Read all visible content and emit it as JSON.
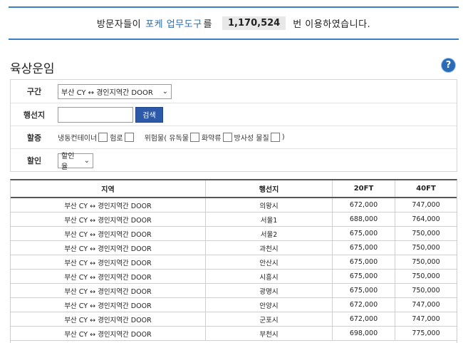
{
  "banner": {
    "prefix": "방문자들이",
    "tool_name": "포케 업무도구",
    "particle": "를",
    "count": "1,170,524",
    "suffix": "번 이용하였습니다."
  },
  "page": {
    "title": "육상운임",
    "help": "?"
  },
  "form": {
    "section": {
      "label": "구간",
      "value": "부산 CY ↔ 경인지역간 DOOR"
    },
    "destination": {
      "label": "행선지",
      "value": "",
      "search_label": "검색"
    },
    "surcharge": {
      "label": "할증",
      "options": [
        "냉동컨테이너",
        "험로",
        "위험물( 유독물",
        "화약류",
        "방사성 물질"
      ],
      "close": ")"
    },
    "discount": {
      "label": "할인",
      "value": "할인율"
    }
  },
  "table": {
    "headers": [
      "지역",
      "행선지",
      "20FT",
      "40FT"
    ],
    "rows": [
      [
        "부산 CY ↔ 경인지역간 DOOR",
        "의왕시",
        "672,000",
        "747,000"
      ],
      [
        "부산 CY ↔ 경인지역간 DOOR",
        "서울1",
        "688,000",
        "764,000"
      ],
      [
        "부산 CY ↔ 경인지역간 DOOR",
        "서울2",
        "675,000",
        "750,000"
      ],
      [
        "부산 CY ↔ 경인지역간 DOOR",
        "과천시",
        "675,000",
        "750,000"
      ],
      [
        "부산 CY ↔ 경인지역간 DOOR",
        "안산시",
        "675,000",
        "750,000"
      ],
      [
        "부산 CY ↔ 경인지역간 DOOR",
        "시흥시",
        "675,000",
        "750,000"
      ],
      [
        "부산 CY ↔ 경인지역간 DOOR",
        "광명시",
        "675,000",
        "750,000"
      ],
      [
        "부산 CY ↔ 경인지역간 DOOR",
        "안양시",
        "672,000",
        "747,000"
      ],
      [
        "부산 CY ↔ 경인지역간 DOOR",
        "군포시",
        "672,000",
        "747,000"
      ],
      [
        "부산 CY ↔ 경인지역간 DOOR",
        "부천시",
        "698,000",
        "775,000"
      ]
    ]
  }
}
